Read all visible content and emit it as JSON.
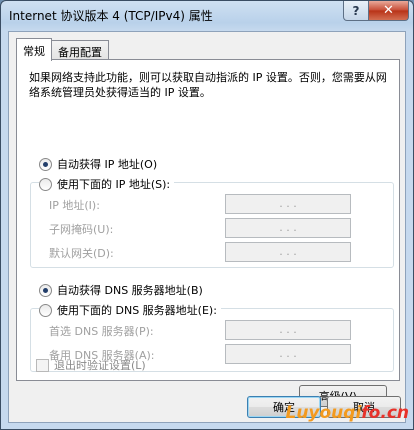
{
  "window": {
    "title": "Internet 协议版本 4 (TCP/IPv4) 属性",
    "help_label": "?",
    "close_label": "✕"
  },
  "tabs": [
    {
      "label": "常规",
      "active": true
    },
    {
      "label": "备用配置",
      "active": false
    }
  ],
  "description": "如果网络支持此功能，则可以获取自动指派的 IP 设置。否则，您需要从网络系统管理员处获得适当的 IP 设置。",
  "ip_section": {
    "auto_label": "自动获得 IP 地址(O)",
    "manual_label": "使用下面的 IP 地址(S):",
    "fields": [
      {
        "label": "IP 地址(I):",
        "value": ". . ."
      },
      {
        "label": "子网掩码(U):",
        "value": ". . ."
      },
      {
        "label": "默认网关(D):",
        "value": ". . ."
      }
    ]
  },
  "dns_section": {
    "auto_label": "自动获得 DNS 服务器地址(B)",
    "manual_label": "使用下面的 DNS 服务器地址(E):",
    "fields": [
      {
        "label": "首选 DNS 服务器(P):",
        "value": ". . ."
      },
      {
        "label": "备用 DNS 服务器(A):",
        "value": ". . ."
      }
    ]
  },
  "validate_label": "退出时验证设置(L)",
  "buttons": {
    "advanced": "高级(V)...",
    "ok": "确定",
    "cancel": "取消"
  },
  "watermark": {
    "part_a": "Luyouqi",
    "part_b": "fo.cn"
  },
  "colors": {
    "title_gradient": "#b9d1ea",
    "close_button": "#c64a33",
    "radio_dot": "#233e6a",
    "disabled_text": "#a0a0a0",
    "watermark_orange": "#f39a1e",
    "watermark_red": "#e8322a"
  }
}
